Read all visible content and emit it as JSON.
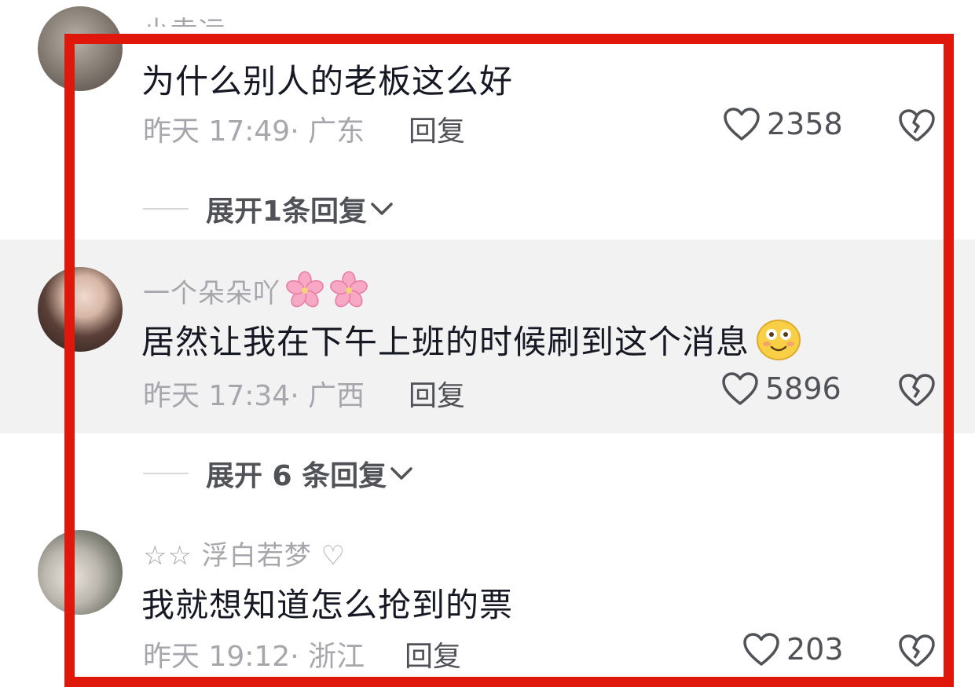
{
  "comments": [
    {
      "username": "小幸运",
      "text": "为什么别人的老板这么好",
      "time": "昨天 17:49· 广东",
      "reply": "回复",
      "likes": "2358",
      "expand": "展开1条回复"
    },
    {
      "username": "一个朵朵吖",
      "text": "居然让我在下午上班的时候刷到这个消息",
      "time": "昨天 17:34· 广西",
      "reply": "回复",
      "likes": "5896",
      "expand": "展开 6 条回复"
    },
    {
      "username": "☆☆ 浮白若梦 ♡",
      "text": "我就想知道怎么抢到的票",
      "time": "昨天 19:12· 浙江",
      "reply": "回复",
      "likes": "203"
    }
  ],
  "icons": {
    "like": "heart-outline-icon",
    "dislike": "broken-heart-icon",
    "expand": "chevron-down-icon",
    "emoji": "smiling-emoji-icon",
    "username_decoration": "cherry-blossom-icon"
  },
  "colors": {
    "highlight_box": "#e0180c",
    "highlighted_row_bg": "#f2f2f3",
    "text_primary": "#161823",
    "text_secondary": "#a6a6ad"
  }
}
